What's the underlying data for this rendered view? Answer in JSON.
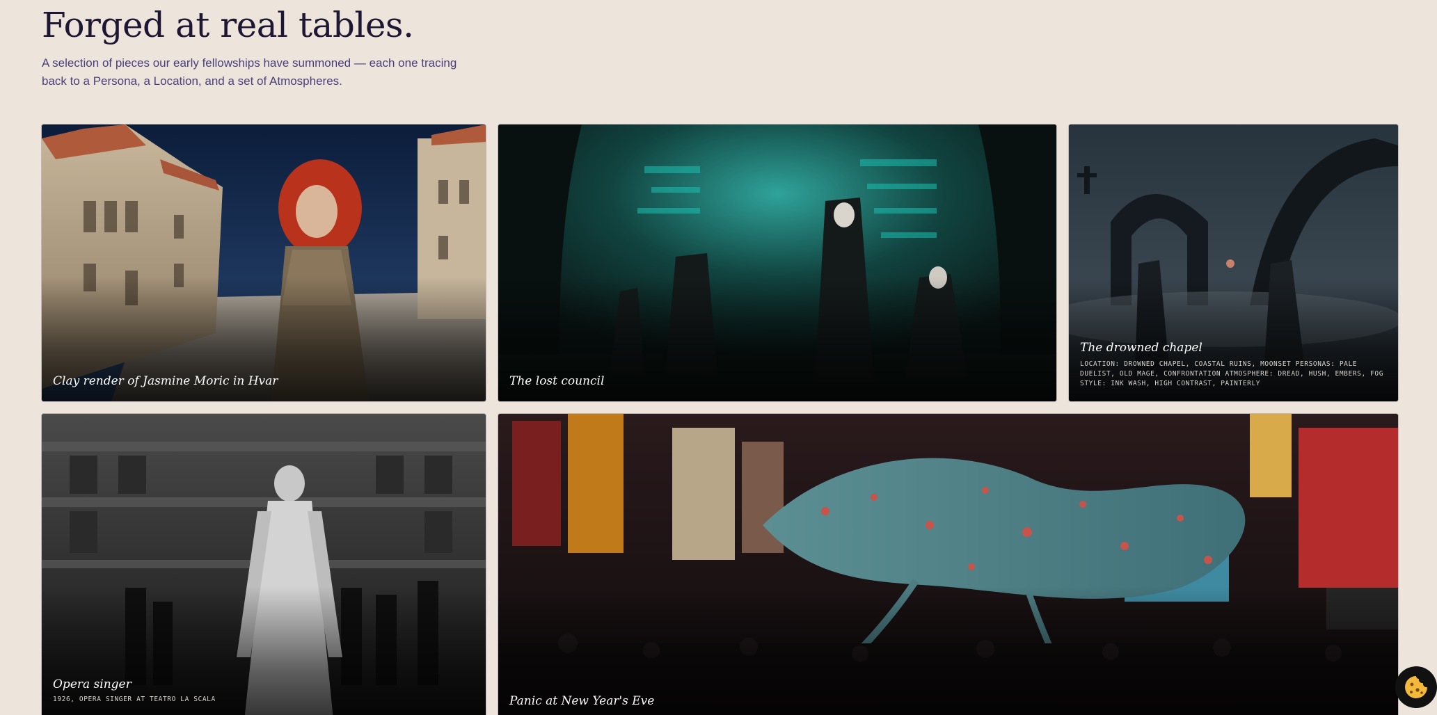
{
  "header": {
    "title": "Forged at real tables.",
    "intro": "A selection of pieces our early fellowships have summoned — each one tracing back to a Persona, a Location, and a set of Atmospheres."
  },
  "gallery": [
    {
      "title": "Clay render of Jasmine Moric in Hvar",
      "meta": ""
    },
    {
      "title": "The lost council",
      "meta": ""
    },
    {
      "title": "The drowned chapel",
      "meta": "LOCATION: DROWNED CHAPEL, COASTAL RUINS, MOONSET PERSONAS: PALE DUELIST, OLD MAGE, CONFRONTATION ATMOSPHERE: DREAD, HUSH, EMBERS, FOG STYLE: INK WASH, HIGH CONTRAST, PAINTERLY"
    },
    {
      "title": "Opera singer",
      "meta": "1926, OPERA SINGER AT TEATRO LA SCALA"
    },
    {
      "title": "Panic at New Year's Eve",
      "meta": ""
    }
  ],
  "icons": {
    "cookie_button": "cookie-icon"
  },
  "colors": {
    "background": "#ede4dc",
    "heading": "#1e1733",
    "intro": "#4a3f7a",
    "cookie_accent": "#f2b93b"
  }
}
